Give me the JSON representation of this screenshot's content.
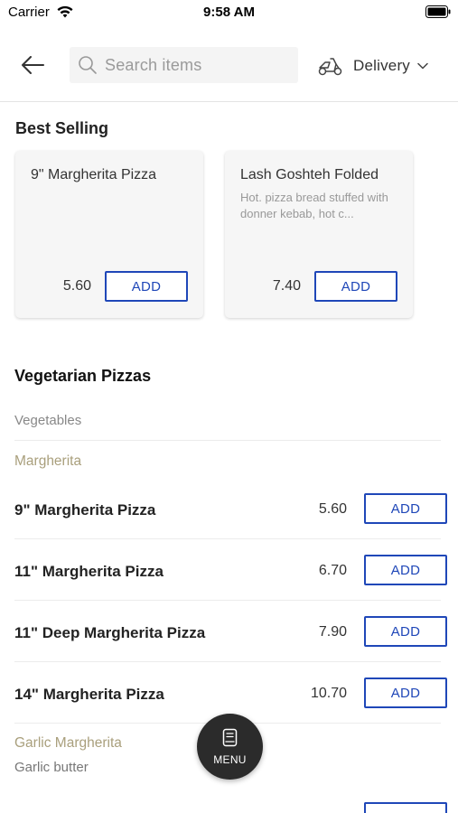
{
  "status_bar": {
    "carrier": "Carrier",
    "time": "9:58 AM"
  },
  "header": {
    "search_placeholder": "Search items",
    "delivery_label": "Delivery"
  },
  "best_selling": {
    "title": "Best Selling",
    "cards": [
      {
        "name": "9\" Margherita Pizza",
        "description": "",
        "price": "5.60",
        "add_label": "ADD"
      },
      {
        "name": "Lash Goshteh Folded",
        "description": "Hot. pizza bread stuffed with donner kebab, hot c...",
        "price": "7.40",
        "add_label": "ADD"
      }
    ]
  },
  "vegetarian": {
    "title": "Vegetarian Pizzas",
    "subtitle": "Vegetables",
    "category_margherita": "Margherita",
    "items": [
      {
        "name": "9\" Margherita Pizza",
        "price": "5.60",
        "add_label": "ADD"
      },
      {
        "name": "11\" Margherita Pizza",
        "price": "6.70",
        "add_label": "ADD"
      },
      {
        "name": "11\" Deep Margherita Pizza",
        "price": "7.90",
        "add_label": "ADD"
      },
      {
        "name": "14\"  Margherita Pizza",
        "price": "10.70",
        "add_label": "ADD"
      }
    ],
    "category_garlic": "Garlic Margherita",
    "garlic_desc": "Garlic butter"
  },
  "fab": {
    "label": "MENU"
  },
  "colors": {
    "accent": "#1f47b8",
    "category": "#a99f7c",
    "fab": "#2b2b2b"
  }
}
